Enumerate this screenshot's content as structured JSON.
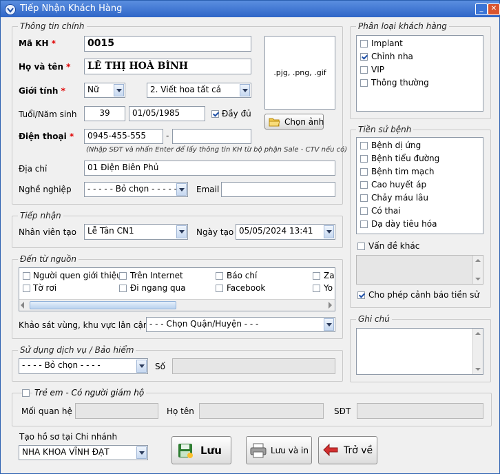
{
  "window": {
    "title": "Tiếp Nhận Khách Hàng"
  },
  "main_info": {
    "legend": "Thông tin chính",
    "ma_kh_label": "Mã KH",
    "ma_kh_value": "0015",
    "ho_ten_label": "Họ và tên",
    "ho_ten_value": "LÊ THỊ HOÀ BÌNH",
    "gioi_tinh_label": "Giới tính",
    "gioi_tinh_value": "Nữ",
    "name_format_value": "2. Viết hoa tất cả",
    "tuoi_label": "Tuổi/Năm sinh",
    "tuoi_value": "39",
    "nam_sinh_value": "01/05/1985",
    "day_du_label": "Đầy đủ",
    "dien_thoai_label": "Điện thoại",
    "dien_thoai_value": "0945-455-555",
    "dash": "-",
    "dien_thoai_2_value": "",
    "phone_hint": "(Nhập SĐT và nhấn Enter để lấy thông tin KH từ bộ phận Sale - CTV nếu có)",
    "dia_chi_label": "Địa chỉ",
    "dia_chi_value": "01 Điện Biên Phủ",
    "nghe_nghiep_label": "Nghề nghiệp",
    "nghe_nghiep_value": "- - - - - Bỏ chọn - - - - -",
    "email_label": "Email",
    "email_value": "",
    "photo_hint": ".pjg, .png, .gif",
    "chon_anh_label": "Chọn ảnh",
    "required_mark": "*"
  },
  "reception": {
    "legend": "Tiếp nhận",
    "nhan_vien_label": "Nhân viên tạo",
    "nhan_vien_value": "Lễ Tân CN1",
    "ngay_tao_label": "Ngày tạo",
    "ngay_tao_value": "05/05/2024 13:41"
  },
  "source": {
    "legend": "Đến từ nguồn",
    "items": [
      {
        "label": "Người quen giới thiệu"
      },
      {
        "label": "Trên Internet"
      },
      {
        "label": "Báo chí"
      },
      {
        "label": "Zal"
      },
      {
        "label": "Tờ rơi"
      },
      {
        "label": "Đi ngang qua"
      },
      {
        "label": "Facebook"
      },
      {
        "label": "Yo"
      }
    ],
    "survey_label": "Khảo sát vùng, khu vực lân cận",
    "survey_value": "- - - Chọn Quận/Huyện - - -"
  },
  "service": {
    "legend": "Sử dụng dịch vụ / Bảo hiểm",
    "value": "- - - - Bỏ chọn - - - -",
    "so_label": "Số",
    "so_value": ""
  },
  "child": {
    "legend": "Trẻ em - Có người giám hộ",
    "moi_quan_he_label": "Mối quan hệ",
    "ho_ten_label": "Họ tên",
    "sdt_label": "SĐT"
  },
  "branch": {
    "label": "Tạo hồ sơ tại Chi nhánh",
    "value": "NHA KHOA VĨNH ĐẠT"
  },
  "buttons": {
    "luu": "Lưu",
    "luu_in": "Lưu và in",
    "tro_ve": "Trở về"
  },
  "classification": {
    "legend": "Phân loại khách hàng",
    "items": [
      {
        "label": "Implant",
        "checked": false
      },
      {
        "label": "Chỉnh nha",
        "checked": true
      },
      {
        "label": "VIP",
        "checked": false
      },
      {
        "label": "Thông thường",
        "checked": false
      }
    ]
  },
  "history": {
    "legend": "Tiền sử bệnh",
    "items": [
      {
        "label": "Bệnh dị ứng"
      },
      {
        "label": "Bệnh tiểu đường"
      },
      {
        "label": "Bệnh tim mạch"
      },
      {
        "label": "Cao huyết áp"
      },
      {
        "label": "Chảy máu lâu"
      },
      {
        "label": "Có thai"
      },
      {
        "label": "Dạ dày tiêu hóa"
      }
    ],
    "van_de_khac_label": "Vấn đề khác",
    "cho_phep_label": "Cho phép cảnh báo tiền sử"
  },
  "notes": {
    "legend": "Ghi chú"
  },
  "colors": {
    "title_bar": "#2f66c8",
    "required": "#e00000",
    "check": "#1d4fa8"
  }
}
